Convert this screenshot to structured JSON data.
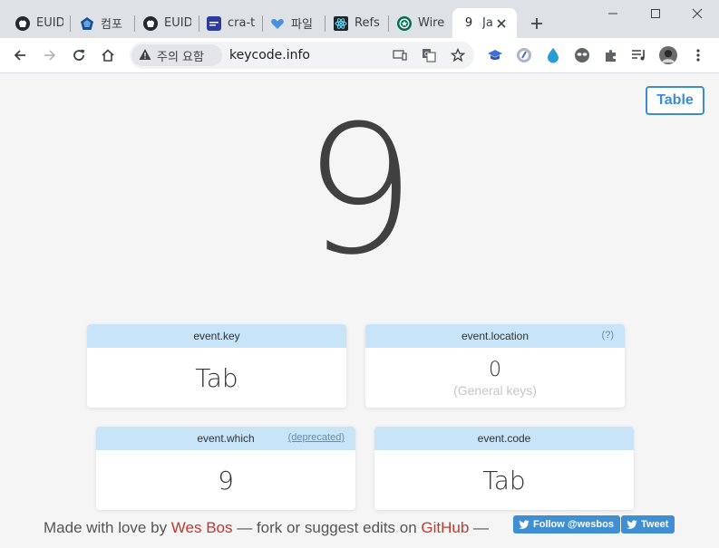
{
  "browser": {
    "tabs": [
      {
        "title": "EUID",
        "icon": "github-icon"
      },
      {
        "title": "컴포",
        "icon": "pentagon-icon"
      },
      {
        "title": "EUID",
        "icon": "github-icon"
      },
      {
        "title": "cra-t",
        "icon": "app-icon"
      },
      {
        "title": "파일",
        "icon": "heart-icon"
      },
      {
        "title": "Refs",
        "icon": "react-icon"
      },
      {
        "title": "Wire",
        "icon": "starbucks-icon"
      },
      {
        "title": "Ja",
        "favicon_text": "9",
        "icon": "keycode-icon",
        "active": true
      }
    ],
    "security_label": "주의 요함",
    "url": "keycode.info"
  },
  "page": {
    "table_button": "Table",
    "big_key": "9",
    "cards": {
      "key": {
        "title": "event.key",
        "value": "Tab"
      },
      "location": {
        "title": "event.location",
        "help": "(?)",
        "value": "0",
        "note": "(General keys)"
      },
      "which": {
        "title": "event.which",
        "badge": "(deprecated)",
        "value": "9"
      },
      "code": {
        "title": "event.code",
        "value": "Tab"
      }
    },
    "footer": {
      "prefix": "Made with love by ",
      "author": "Wes Bos",
      "middle": " — fork or suggest edits on ",
      "repo": "GitHub",
      "suffix": " —",
      "follow_button": "Follow @wesbos",
      "tweet_button": "Tweet"
    }
  },
  "colors": {
    "accent": "#3d8bd0",
    "card_header": "#c8e4f8",
    "link_red": "#c0392b",
    "twitter_blue": "#3f8fd2"
  }
}
